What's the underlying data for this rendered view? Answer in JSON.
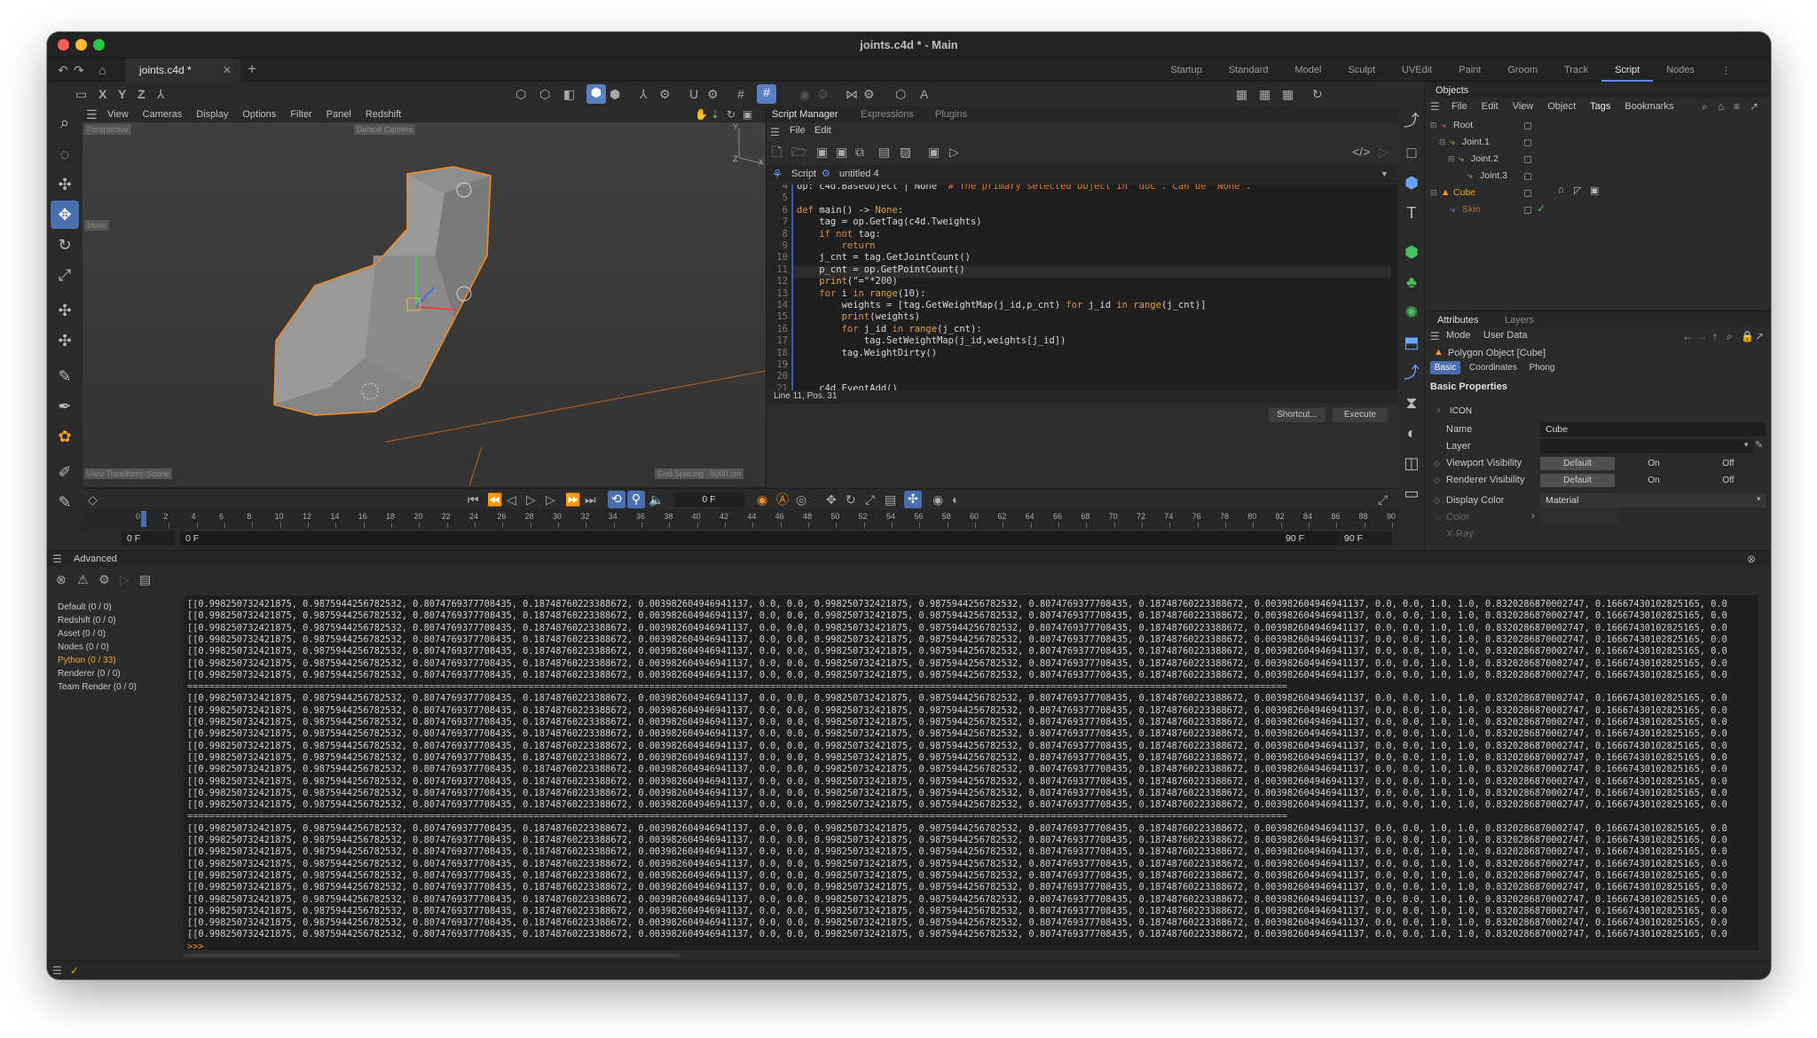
{
  "window": {
    "title": "joints.c4d * - Main",
    "document_tab": "joints.c4d *"
  },
  "layouts": [
    "Startup",
    "Standard",
    "Model",
    "Sculpt",
    "UVEdit",
    "Paint",
    "Groom",
    "Track",
    "Script",
    "Nodes"
  ],
  "viewport": {
    "menu": [
      "View",
      "Cameras",
      "Display",
      "Options",
      "Filter",
      "Panel",
      "Redshift"
    ],
    "view_label": "Perspective",
    "camera_label": "Default Camera",
    "move_label": "Move",
    "transform_label": "View Transform: Scene",
    "grid_label": "Grid Spacing : 5000 cm",
    "axis_y": "Y",
    "axis_z": "Z",
    "axis_x": "X"
  },
  "toolbar": {
    "x": "X",
    "y": "Y",
    "z": "Z"
  },
  "script_manager": {
    "tabs": [
      "Script Manager",
      "Expressions",
      "Plugins"
    ],
    "menu": [
      "File",
      "Edit"
    ],
    "script_label": "Script",
    "script_name": "untitled 4",
    "status": "Line 11, Pos. 31",
    "shortcut_btn": "Shortcut...",
    "execute_btn": "Execute"
  },
  "code_lines": [
    {
      "n": "4",
      "t": "op: c4d.BaseObject | None  # The primary selected object in `doc`. Can be `None`."
    },
    {
      "n": "5",
      "t": ""
    },
    {
      "n": "6",
      "t": "def main() -> None:"
    },
    {
      "n": "7",
      "t": "    tag = op.GetTag(c4d.Tweights)"
    },
    {
      "n": "8",
      "t": "    if not tag:"
    },
    {
      "n": "9",
      "t": "        return"
    },
    {
      "n": "10",
      "t": "    j_cnt = tag.GetJointCount()"
    },
    {
      "n": "11",
      "t": "    p_cnt = op.GetPointCount()"
    },
    {
      "n": "12",
      "t": "    print(\"=\"*200)"
    },
    {
      "n": "13",
      "t": "    for i in range(10):"
    },
    {
      "n": "14",
      "t": "        weights = [tag.GetWeightMap(j_id,p_cnt) for j_id in range(j_cnt)]"
    },
    {
      "n": "15",
      "t": "        print(weights)"
    },
    {
      "n": "16",
      "t": "        for j_id in range(j_cnt):"
    },
    {
      "n": "17",
      "t": "            tag.SetWeightMap(j_id,weights[j_id])"
    },
    {
      "n": "18",
      "t": "        tag.WeightDirty()"
    },
    {
      "n": "19",
      "t": ""
    },
    {
      "n": "20",
      "t": ""
    },
    {
      "n": "21",
      "t": "    c4d.EventAdd()"
    }
  ],
  "objects": {
    "tab": "Objects",
    "menu": [
      "File",
      "Edit",
      "View",
      "Object",
      "Tags",
      "Bookmarks"
    ],
    "items": [
      {
        "name": "Root"
      },
      {
        "name": "Joint.1"
      },
      {
        "name": "Joint.2"
      },
      {
        "name": "Joint.3"
      },
      {
        "name": "Cube"
      },
      {
        "name": "Skin"
      }
    ]
  },
  "attributes": {
    "tabs": [
      "Attributes",
      "Layers"
    ],
    "menu": [
      "Mode",
      "User Data"
    ],
    "object_type": "Polygon Object [Cube]",
    "subtabs": [
      "Basic",
      "Coordinates",
      "Phong"
    ],
    "section": "Basic Properties",
    "group": "ICON",
    "name_label": "Name",
    "name_value": "Cube",
    "layer_label": "Layer",
    "viewport_label": "Viewport Visibility",
    "renderer_label": "Renderer Visibility",
    "display_color_label": "Display Color",
    "display_color_value": "Material",
    "color_label": "Color",
    "xray_label": "X-Ray",
    "vis_options": [
      "Default",
      "On",
      "Off"
    ]
  },
  "timeline": {
    "frame_field": "0 F",
    "ticks": [
      "0",
      "2",
      "4",
      "6",
      "8",
      "10",
      "12",
      "14",
      "16",
      "18",
      "20",
      "22",
      "24",
      "26",
      "28",
      "30",
      "32",
      "34",
      "36",
      "38",
      "40",
      "42",
      "44",
      "46",
      "48",
      "50",
      "52",
      "54",
      "56",
      "58",
      "60",
      "62",
      "64",
      "66",
      "68",
      "70",
      "72",
      "74",
      "76",
      "78",
      "80",
      "82",
      "84",
      "86",
      "88",
      "90"
    ],
    "start_a": "0 F",
    "start_b": "0 F",
    "end_a": "90 F",
    "end_b": "90 F"
  },
  "console": {
    "title": "Advanced",
    "categories": [
      "Default (0 / 0)",
      "Redshift (0 / 0)",
      "Asset (0 / 0)",
      "Nodes (0 / 0)",
      "Python (0 / 33)",
      "Renderer (0 / 0)",
      "Team Render  (0 / 0)"
    ],
    "line_text": "[[0.9982507324218​75, 0.987594425678​2532, 0.807476937​7708435, 0.187487602​23388672, 0.003982604​946941137, 0.0, 0.0, 0.998250732​421875, 0.987594425​6782532, 0.807476937​7708435, 0.187487602​23388672, 0.003982604​946941137, 0.0, 0.0, 1.0, 1.0, 0.832028687​0002747, 0.166674301​02825165, 0.0",
    "separator": "========================================================================================================================================================================================================",
    "prompt": ">>>"
  },
  "colors": {
    "accent": "#5a8ee0",
    "orange": "#f08a24",
    "panel": "#2b2b2b",
    "dark": "#1e1e1e"
  }
}
